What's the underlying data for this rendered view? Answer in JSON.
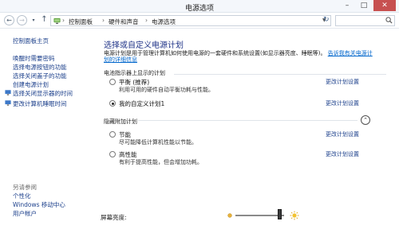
{
  "window": {
    "title": "电源选项",
    "minimize": "–",
    "maximize": "□",
    "close": "✕"
  },
  "nav": {
    "back": "←",
    "forward": "→",
    "recent": "▾",
    "up": "↑",
    "breadcrumbs": [
      "控制面板",
      "硬件和声音",
      "电源选项"
    ],
    "refresh": "↻",
    "search_placeholder": ""
  },
  "sidebar": {
    "home": "控制面板主页",
    "links": [
      "唤醒时需要密码",
      "选择电源按钮的功能",
      "选择关闭盖子的功能",
      "创建电源计划",
      "选择关闭显示器的时间",
      "更改计算机睡眠时间"
    ],
    "see_also_title": "另请参阅",
    "see_also": [
      "个性化",
      "Windows 移动中心",
      "用户帐户"
    ]
  },
  "main": {
    "title": "选择或自定义电源计划",
    "description": "电源计划是用于管理计算机如何使用电源的一套硬件和系统设置(如显示器亮度、睡眠等)。",
    "description_link": "告诉我有关电源计划的详细信息",
    "battery_section": "电池指示器上显示的计划",
    "hidden_section": "隐藏附加计划",
    "plans": [
      {
        "name": "平衡 (推荐)",
        "desc": "利用可用的硬件自动平衡功耗与性能。",
        "link": "更改计划设置",
        "checked": false
      },
      {
        "name": "我的自定义计划1",
        "desc": "",
        "link": "更改计划设置",
        "checked": true
      }
    ],
    "hidden_plans": [
      {
        "name": "节能",
        "desc": "尽可能降低计算机性能以节能。",
        "link": "更改计划设置",
        "checked": false
      },
      {
        "name": "高性能",
        "desc": "有利于提高性能，但会增加功耗。",
        "link": "更改计划设置",
        "checked": false
      }
    ],
    "collapse_symbol": "⌃"
  },
  "bottom": {
    "brightness_label": "屏幕亮度:",
    "brightness_level": 0.94
  },
  "colors": {
    "link": "#1b3f8b",
    "title": "#1e3287",
    "close_button": "#c75050"
  }
}
